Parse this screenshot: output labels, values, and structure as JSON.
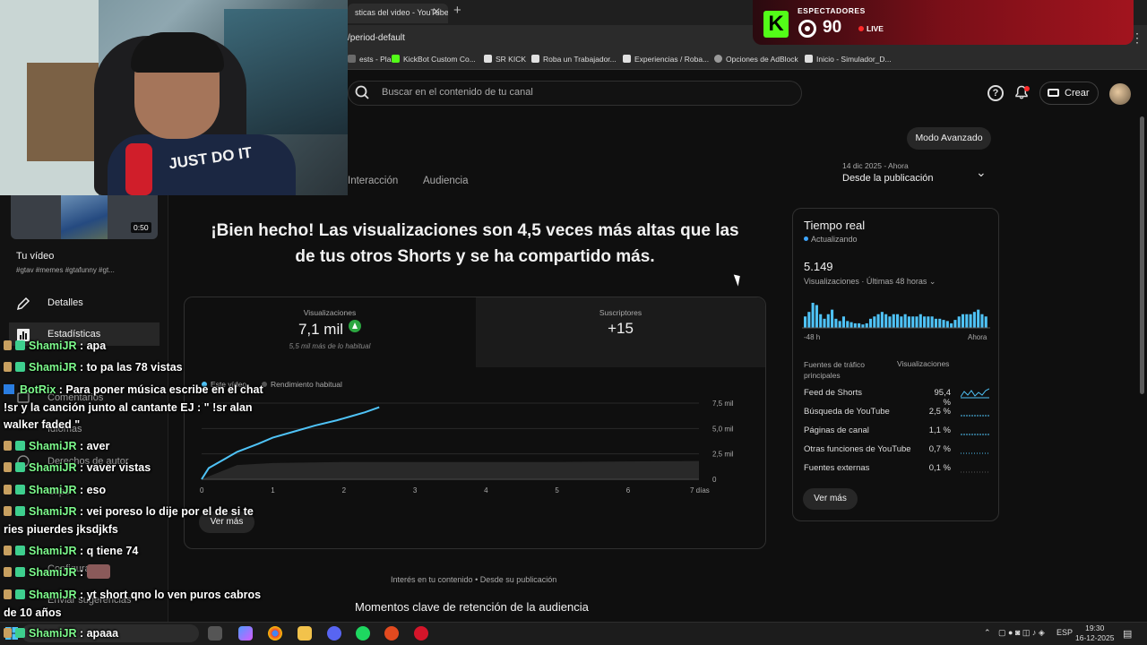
{
  "browser": {
    "tab_title": "sticas del video - YouTube",
    "url": "/period-default",
    "bookmarks": [
      {
        "label": "ests - Pla...",
        "color": "#6b6b6b"
      },
      {
        "label": "KickBot Custom Co...",
        "color": "#53fc18"
      },
      {
        "label": "SR KICK",
        "color": "#e0e0e0"
      },
      {
        "label": "Roba un Trabajador...",
        "color": "#e0e0e0"
      },
      {
        "label": "Experiencias / Roba...",
        "color": "#e0e0e0"
      },
      {
        "label": "Opciones de AdBlock",
        "color": "#9a9a9a"
      },
      {
        "label": "Inicio - Simulador_D...",
        "color": "#dddddd"
      }
    ]
  },
  "kick_overlay": {
    "logo": "K",
    "label": "ESPECTADORES",
    "viewers": "90",
    "live": "LIVE"
  },
  "webcam": {
    "shirt_text": "JUST DO IT"
  },
  "header": {
    "search_placeholder": "Buscar en el contenido de tu canal",
    "create_label": "Crear",
    "mode_label": "Modo Avanzado"
  },
  "tabs": [
    {
      "label": "Interacción"
    },
    {
      "label": "Audiencia"
    }
  ],
  "date_selector": {
    "range": "14 dic 2025 - Ahora",
    "label": "Desde la publicación"
  },
  "headline": "¡Bien hecho! Las visualizaciones son 4,5 veces más altas que las de tus otros Shorts y se ha compartido más.",
  "metrics": {
    "views_label": "Visualizaciones",
    "views_value": "7,1 mil",
    "views_note": "5,5 mil más de lo habitual",
    "subs_label": "Suscriptores",
    "subs_value": "+15"
  },
  "main_chart_legend": {
    "a": "Este vídeo",
    "b": "Rendimiento habitual"
  },
  "ver_mas": "Ver más",
  "chart_data": [
    {
      "type": "line",
      "x_ticks": [
        "0",
        "1",
        "2",
        "3",
        "4",
        "5",
        "6",
        "7 días"
      ],
      "y_ticks": [
        "0",
        "2,5 mil",
        "5,0 mil",
        "7,5 mil"
      ],
      "ylim": [
        0,
        7500
      ],
      "series": [
        {
          "name": "Este vídeo",
          "color": "#4fc3f7",
          "x": [
            0,
            0.1,
            0.3,
            0.5,
            0.8,
            1.0,
            1.3,
            1.6,
            1.9,
            2.1,
            2.3,
            2.5
          ],
          "y": [
            0,
            1100,
            1900,
            2700,
            3500,
            4100,
            4700,
            5300,
            5800,
            6200,
            6600,
            7100
          ]
        },
        {
          "name": "Rendimiento habitual",
          "color": "#3a3a3a",
          "x": [
            0,
            0.5,
            1,
            2,
            3,
            4,
            5,
            6,
            7
          ],
          "y": [
            0,
            1400,
            1600,
            1700,
            1700,
            1700,
            1700,
            1750,
            1800
          ]
        }
      ]
    },
    {
      "type": "bar",
      "title": "Tiempo real",
      "x_ticks": [
        "-48 h",
        "Ahora"
      ],
      "values": [
        10,
        14,
        22,
        20,
        12,
        8,
        12,
        16,
        8,
        6,
        10,
        6,
        5,
        4,
        4,
        3,
        4,
        8,
        10,
        12,
        14,
        12,
        10,
        12,
        12,
        10,
        12,
        10,
        10,
        10,
        12,
        10,
        10,
        10,
        8,
        8,
        7,
        6,
        4,
        7,
        10,
        12,
        12,
        12,
        14,
        16,
        12,
        10
      ]
    }
  ],
  "realtime": {
    "title": "Tiempo real",
    "updating": "Actualizando",
    "views": "5.149",
    "subtitle": "Visualizaciones · Últimas 48 horas",
    "axis_start": "-48 h",
    "axis_end": "Ahora",
    "col1": "Fuentes de tráfico principales",
    "col2": "Visualizaciones",
    "sources": [
      {
        "name": "Feed de Shorts",
        "pct": "95,4 %"
      },
      {
        "name": "Búsqueda de YouTube",
        "pct": "2,5 %"
      },
      {
        "name": "Páginas de canal",
        "pct": "1,1 %"
      },
      {
        "name": "Otras funciones de YouTube",
        "pct": "0,7 %"
      },
      {
        "name": "Fuentes externas",
        "pct": "0,1 %"
      }
    ]
  },
  "footer": {
    "interest": "Interés en tu contenido • Desde su publicación",
    "key_moments": "Momentos clave de retención de la audiencia"
  },
  "sidebar": {
    "thumb_duration": "0:50",
    "video_title": "Tu vídeo",
    "tags": "#gtav #memes #gtafunny #gt...",
    "items": [
      {
        "label": "Detalles"
      },
      {
        "label": "Estadísticas"
      },
      {
        "label": "Comentarios"
      },
      {
        "label": "Idiomas"
      },
      {
        "label": "Derechos de autor"
      },
      {
        "label": "Clips"
      },
      {
        "label": "Configuración"
      },
      {
        "label": "Enviar sugerencias"
      }
    ]
  },
  "chat": [
    {
      "user": "ShamiJR",
      "msg": " : apa"
    },
    {
      "user": "ShamiJR",
      "msg": " : to pa las 78 vistas"
    },
    {
      "user": "BotRix",
      "msg": " : Para poner música escribe en el chat"
    },
    {
      "user": "",
      "msg": "!sr y la canción junto al cantante EJ : \" !sr alan"
    },
    {
      "user": "",
      "msg": "walker faded \""
    },
    {
      "user": "ShamiJR",
      "msg": " : aver"
    },
    {
      "user": "ShamiJR",
      "msg": " : vaver vistas"
    },
    {
      "user": "ShamiJR",
      "msg": " : eso"
    },
    {
      "user": "ShamiJR",
      "msg": " : vei poreso lo dije por el de si te"
    },
    {
      "user": "",
      "msg": "ries piuerdes jksdjkfs"
    },
    {
      "user": "ShamiJR",
      "msg": " : q tiene 74"
    },
    {
      "user": "ShamiJR",
      "msg": " :"
    },
    {
      "user": "ShamiJR",
      "msg": " : yt short qno lo ven puros cabros"
    },
    {
      "user": "",
      "msg": "de 10 años"
    },
    {
      "user": "ShamiJR",
      "msg": " : apaaa"
    }
  ],
  "taskbar": {
    "lang": "ESP",
    "time": "19:30",
    "date": "16-12-2025"
  }
}
